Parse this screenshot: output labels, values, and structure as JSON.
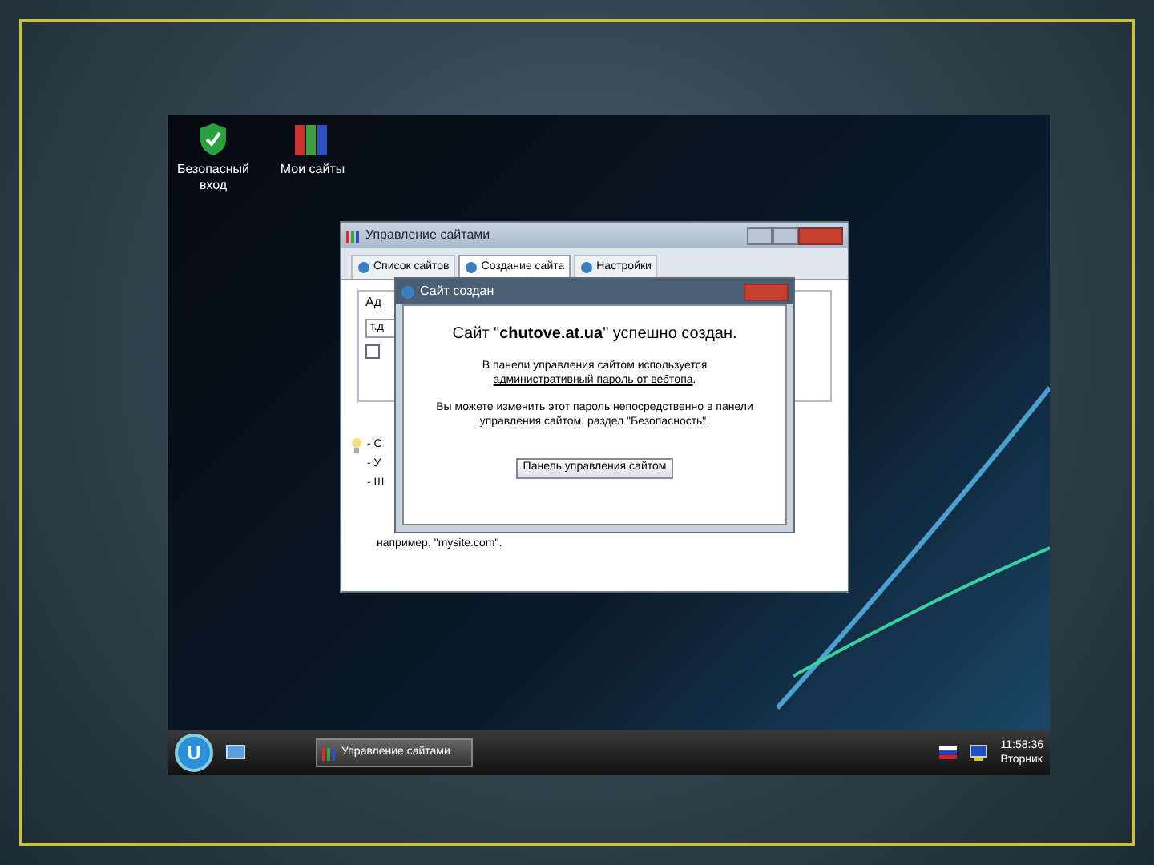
{
  "desktop_icons": [
    {
      "label": "Безопасный вход",
      "kind": "shield"
    },
    {
      "label": "Мои сайты",
      "kind": "binders"
    }
  ],
  "window": {
    "title": "Управление сайтами",
    "tabs": [
      {
        "label": "Список сайтов",
        "selected": false
      },
      {
        "label": "Создание сайта",
        "selected": true
      },
      {
        "label": "Настройки",
        "selected": false
      }
    ],
    "group_label": "Ад",
    "field_value": "т.д",
    "checkbox_checked": false,
    "hints": [
      "- С",
      "- У",
      "- Ш"
    ],
    "example": "например, \"mysite.com\"."
  },
  "dialog": {
    "title": "Сайт создан",
    "heading": "Сайт \"**chutove.at.ua**\" успешно создан.",
    "paragraphs": [
      {
        "text": "В панели управления сайтом используется",
        "link": "административный пароль от вебтопа",
        "tail": "."
      },
      {
        "text": "Вы можете изменить этот пароль непосредственно в панели управления сайтом, раздел \"Безопасность\"."
      }
    ],
    "button": "Панель управления сайтом"
  },
  "taskbar": {
    "start": "U",
    "task": "Управление сайтами",
    "time": "11:58:36",
    "day": "Вторник"
  }
}
